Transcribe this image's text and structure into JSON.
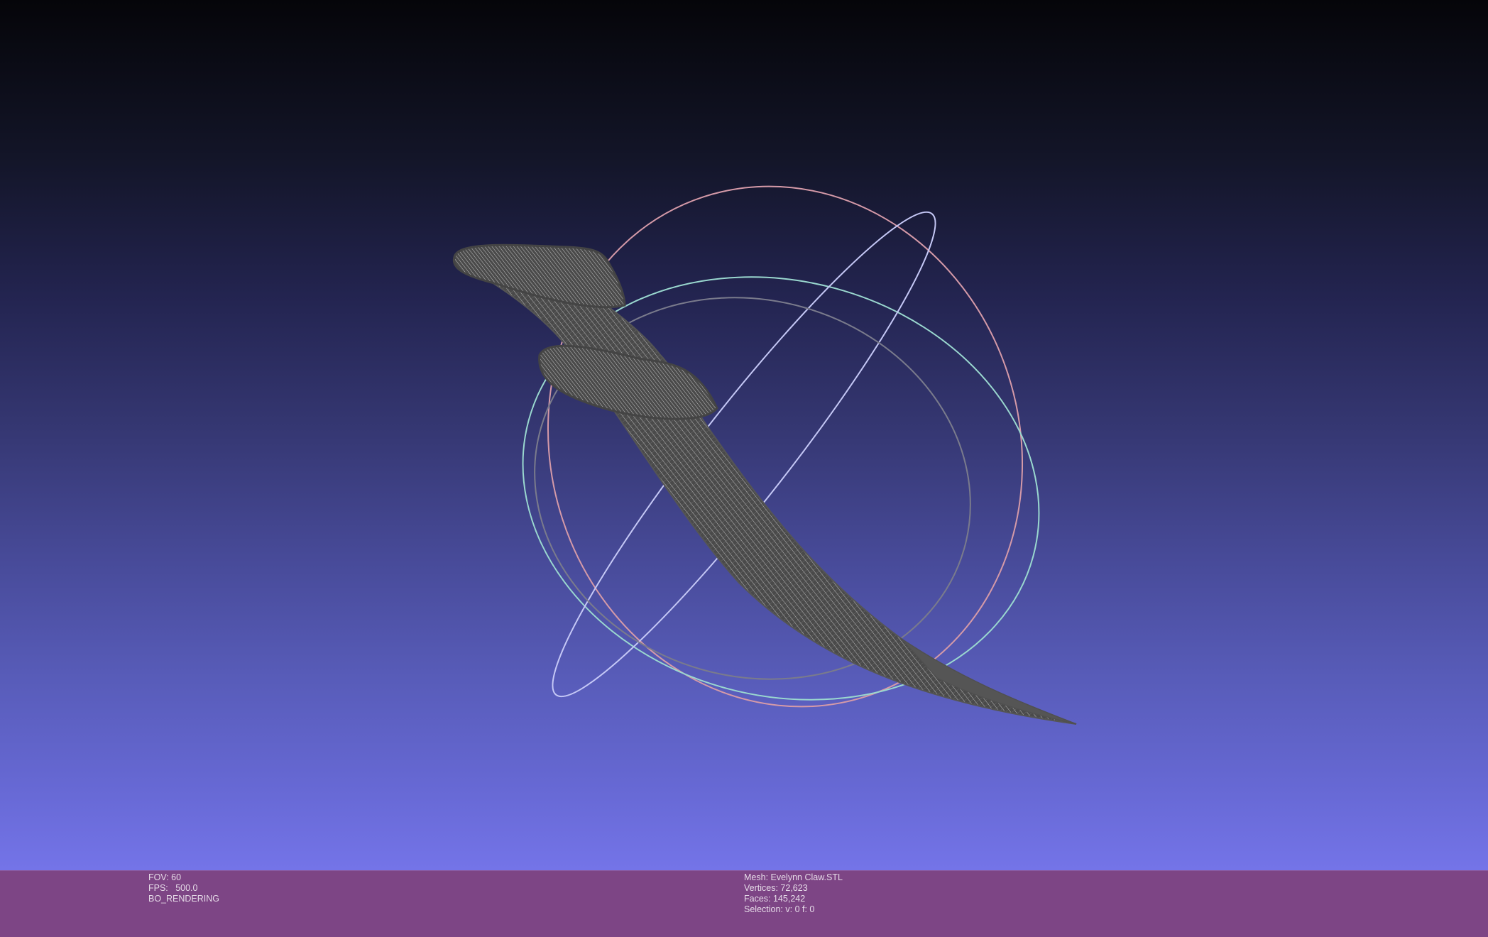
{
  "viewer": {
    "background_top": "#050509",
    "background_bottom": "#7474e8",
    "info_bar_color": "#7d4585"
  },
  "scene": {
    "mesh_color": "#4a4a4a",
    "wireframe_color": "#c8c8c8",
    "trackball_colors": [
      "#d59aa8",
      "#c5c8f6",
      "#9ad8cf",
      "#777788"
    ]
  },
  "info": {
    "fov": "FOV: 60",
    "fps": "FPS:   500.0",
    "rendering": "BO_RENDERING",
    "mesh": "Mesh: Evelynn Claw.STL",
    "vertices": "Vertices: 72,623",
    "faces": "Faces: 145,242",
    "selection": "Selection: v: 0 f: 0"
  }
}
